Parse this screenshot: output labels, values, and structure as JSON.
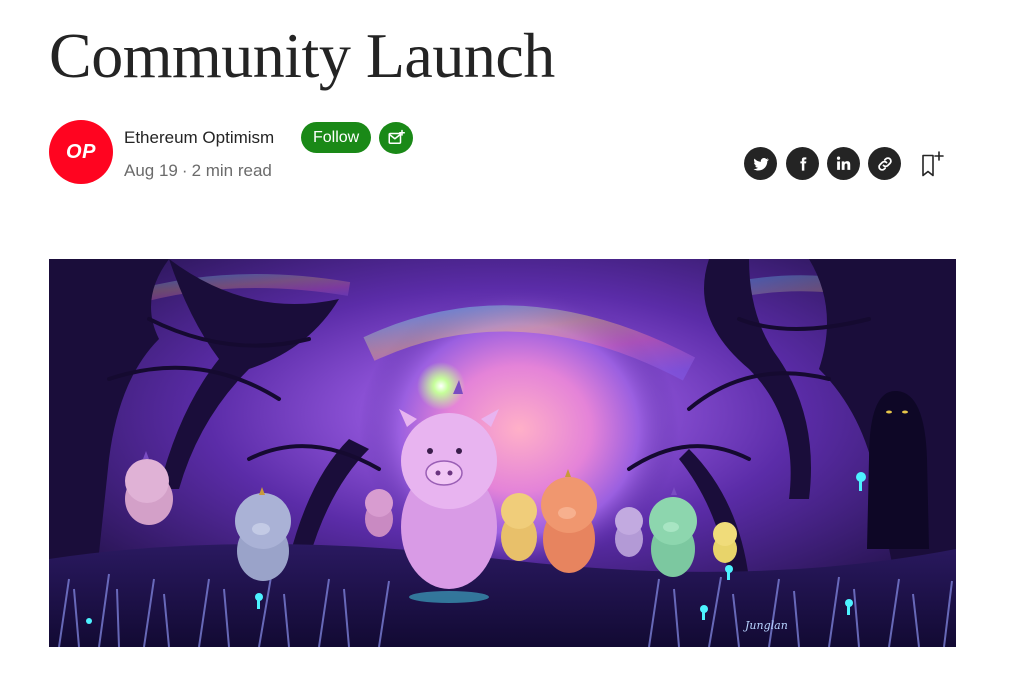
{
  "article": {
    "title": "Community Launch"
  },
  "author": {
    "name": "Ethereum Optimism",
    "avatar_text": "OP",
    "brand_color": "#ff0420"
  },
  "actions": {
    "follow_label": "Follow",
    "accent_color": "#1a8917"
  },
  "meta": {
    "date": "Aug 19",
    "separator": "·",
    "read_time": "2 min read"
  },
  "share": [
    {
      "icon": "twitter-icon"
    },
    {
      "icon": "facebook-icon"
    },
    {
      "icon": "linkedin-icon"
    },
    {
      "icon": "link-icon"
    }
  ],
  "bookmark": {
    "icon": "bookmark-add-icon"
  },
  "hero_image": {
    "signature": "Junglan"
  }
}
